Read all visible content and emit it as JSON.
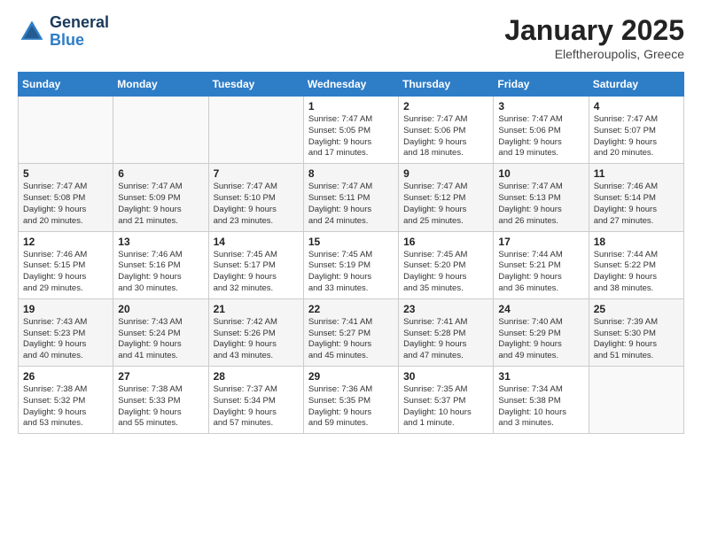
{
  "header": {
    "logo_general": "General",
    "logo_blue": "Blue",
    "title": "January 2025",
    "location": "Eleftheroupolis, Greece"
  },
  "weekdays": [
    "Sunday",
    "Monday",
    "Tuesday",
    "Wednesday",
    "Thursday",
    "Friday",
    "Saturday"
  ],
  "weeks": [
    [
      {
        "day": "",
        "info": ""
      },
      {
        "day": "",
        "info": ""
      },
      {
        "day": "",
        "info": ""
      },
      {
        "day": "1",
        "info": "Sunrise: 7:47 AM\nSunset: 5:05 PM\nDaylight: 9 hours\nand 17 minutes."
      },
      {
        "day": "2",
        "info": "Sunrise: 7:47 AM\nSunset: 5:06 PM\nDaylight: 9 hours\nand 18 minutes."
      },
      {
        "day": "3",
        "info": "Sunrise: 7:47 AM\nSunset: 5:06 PM\nDaylight: 9 hours\nand 19 minutes."
      },
      {
        "day": "4",
        "info": "Sunrise: 7:47 AM\nSunset: 5:07 PM\nDaylight: 9 hours\nand 20 minutes."
      }
    ],
    [
      {
        "day": "5",
        "info": "Sunrise: 7:47 AM\nSunset: 5:08 PM\nDaylight: 9 hours\nand 20 minutes."
      },
      {
        "day": "6",
        "info": "Sunrise: 7:47 AM\nSunset: 5:09 PM\nDaylight: 9 hours\nand 21 minutes."
      },
      {
        "day": "7",
        "info": "Sunrise: 7:47 AM\nSunset: 5:10 PM\nDaylight: 9 hours\nand 23 minutes."
      },
      {
        "day": "8",
        "info": "Sunrise: 7:47 AM\nSunset: 5:11 PM\nDaylight: 9 hours\nand 24 minutes."
      },
      {
        "day": "9",
        "info": "Sunrise: 7:47 AM\nSunset: 5:12 PM\nDaylight: 9 hours\nand 25 minutes."
      },
      {
        "day": "10",
        "info": "Sunrise: 7:47 AM\nSunset: 5:13 PM\nDaylight: 9 hours\nand 26 minutes."
      },
      {
        "day": "11",
        "info": "Sunrise: 7:46 AM\nSunset: 5:14 PM\nDaylight: 9 hours\nand 27 minutes."
      }
    ],
    [
      {
        "day": "12",
        "info": "Sunrise: 7:46 AM\nSunset: 5:15 PM\nDaylight: 9 hours\nand 29 minutes."
      },
      {
        "day": "13",
        "info": "Sunrise: 7:46 AM\nSunset: 5:16 PM\nDaylight: 9 hours\nand 30 minutes."
      },
      {
        "day": "14",
        "info": "Sunrise: 7:45 AM\nSunset: 5:17 PM\nDaylight: 9 hours\nand 32 minutes."
      },
      {
        "day": "15",
        "info": "Sunrise: 7:45 AM\nSunset: 5:19 PM\nDaylight: 9 hours\nand 33 minutes."
      },
      {
        "day": "16",
        "info": "Sunrise: 7:45 AM\nSunset: 5:20 PM\nDaylight: 9 hours\nand 35 minutes."
      },
      {
        "day": "17",
        "info": "Sunrise: 7:44 AM\nSunset: 5:21 PM\nDaylight: 9 hours\nand 36 minutes."
      },
      {
        "day": "18",
        "info": "Sunrise: 7:44 AM\nSunset: 5:22 PM\nDaylight: 9 hours\nand 38 minutes."
      }
    ],
    [
      {
        "day": "19",
        "info": "Sunrise: 7:43 AM\nSunset: 5:23 PM\nDaylight: 9 hours\nand 40 minutes."
      },
      {
        "day": "20",
        "info": "Sunrise: 7:43 AM\nSunset: 5:24 PM\nDaylight: 9 hours\nand 41 minutes."
      },
      {
        "day": "21",
        "info": "Sunrise: 7:42 AM\nSunset: 5:26 PM\nDaylight: 9 hours\nand 43 minutes."
      },
      {
        "day": "22",
        "info": "Sunrise: 7:41 AM\nSunset: 5:27 PM\nDaylight: 9 hours\nand 45 minutes."
      },
      {
        "day": "23",
        "info": "Sunrise: 7:41 AM\nSunset: 5:28 PM\nDaylight: 9 hours\nand 47 minutes."
      },
      {
        "day": "24",
        "info": "Sunrise: 7:40 AM\nSunset: 5:29 PM\nDaylight: 9 hours\nand 49 minutes."
      },
      {
        "day": "25",
        "info": "Sunrise: 7:39 AM\nSunset: 5:30 PM\nDaylight: 9 hours\nand 51 minutes."
      }
    ],
    [
      {
        "day": "26",
        "info": "Sunrise: 7:38 AM\nSunset: 5:32 PM\nDaylight: 9 hours\nand 53 minutes."
      },
      {
        "day": "27",
        "info": "Sunrise: 7:38 AM\nSunset: 5:33 PM\nDaylight: 9 hours\nand 55 minutes."
      },
      {
        "day": "28",
        "info": "Sunrise: 7:37 AM\nSunset: 5:34 PM\nDaylight: 9 hours\nand 57 minutes."
      },
      {
        "day": "29",
        "info": "Sunrise: 7:36 AM\nSunset: 5:35 PM\nDaylight: 9 hours\nand 59 minutes."
      },
      {
        "day": "30",
        "info": "Sunrise: 7:35 AM\nSunset: 5:37 PM\nDaylight: 10 hours\nand 1 minute."
      },
      {
        "day": "31",
        "info": "Sunrise: 7:34 AM\nSunset: 5:38 PM\nDaylight: 10 hours\nand 3 minutes."
      },
      {
        "day": "",
        "info": ""
      }
    ]
  ]
}
